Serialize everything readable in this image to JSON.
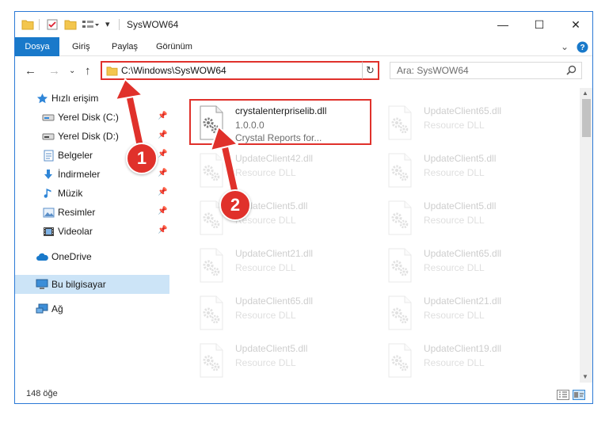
{
  "window": {
    "title": "SysWOW64",
    "controls": {
      "minimize": "—",
      "maximize": "☐",
      "close": "✕"
    }
  },
  "ribbon": {
    "tabs": [
      "Dosya",
      "Giriş",
      "Paylaş",
      "Görünüm"
    ],
    "expand": "⌄",
    "help": "?"
  },
  "navigation": {
    "back": "←",
    "forward": "→",
    "recent": "⌄",
    "up": "↑",
    "address_path": "C:\\Windows\\SysWOW64",
    "address_dropdown": "⌄",
    "refresh": "↻",
    "search_placeholder": "Ara: SysWOW64"
  },
  "sidebar": {
    "items": [
      {
        "label": "Hızlı erişim",
        "icon": "star-icon"
      },
      {
        "label": "Yerel Disk (C:)",
        "icon": "drive-icon",
        "pinned": true
      },
      {
        "label": "Yerel Disk (D:)",
        "icon": "drive-icon",
        "pinned": true
      },
      {
        "label": "Belgeler",
        "icon": "documents-icon",
        "pinned": true
      },
      {
        "label": "İndirmeler",
        "icon": "download-icon",
        "pinned": true
      },
      {
        "label": "Müzik",
        "icon": "music-icon",
        "pinned": true
      },
      {
        "label": "Resimler",
        "icon": "pictures-icon",
        "pinned": true
      },
      {
        "label": "Videolar",
        "icon": "videos-icon",
        "pinned": true
      },
      {
        "label": "OneDrive",
        "icon": "cloud-icon"
      },
      {
        "label": "Bu bilgisayar",
        "icon": "computer-icon",
        "selected": true
      },
      {
        "label": "Ağ",
        "icon": "network-icon"
      }
    ],
    "pin_glyph": "📌"
  },
  "files": [
    {
      "name": "crystalenterpriselib.dll",
      "line2": "1.0.0.0",
      "line3": "Crystal Reports for...",
      "highlight": true
    },
    {
      "name": "UpdateClient65.dll",
      "line2": "Resource DLL"
    },
    {
      "name": "UpdateClient42.dll",
      "line2": "Resource DLL"
    },
    {
      "name": "UpdateClient5.dll",
      "line2": "Resource DLL"
    },
    {
      "name": "UpdateClient5.dll",
      "line2": "Resource DLL"
    },
    {
      "name": "UpdateClient5.dll",
      "line2": "Resource DLL"
    },
    {
      "name": "UpdateClient21.dll",
      "line2": "Resource DLL"
    },
    {
      "name": "UpdateClient65.dll",
      "line2": "Resource DLL"
    },
    {
      "name": "UpdateClient65.dll",
      "line2": "Resource DLL"
    },
    {
      "name": "UpdateClient21.dll",
      "line2": "Resource DLL"
    },
    {
      "name": "UpdateClient5.dll",
      "line2": "Resource DLL"
    },
    {
      "name": "UpdateClient19.dll",
      "line2": "Resource DLL"
    }
  ],
  "status": {
    "count": "148 öğe"
  },
  "annotations": {
    "step1": "1",
    "step2": "2"
  },
  "colors": {
    "accent": "#1979ca",
    "highlight_red": "#e0312b",
    "selected_bg": "#cce4f7"
  }
}
